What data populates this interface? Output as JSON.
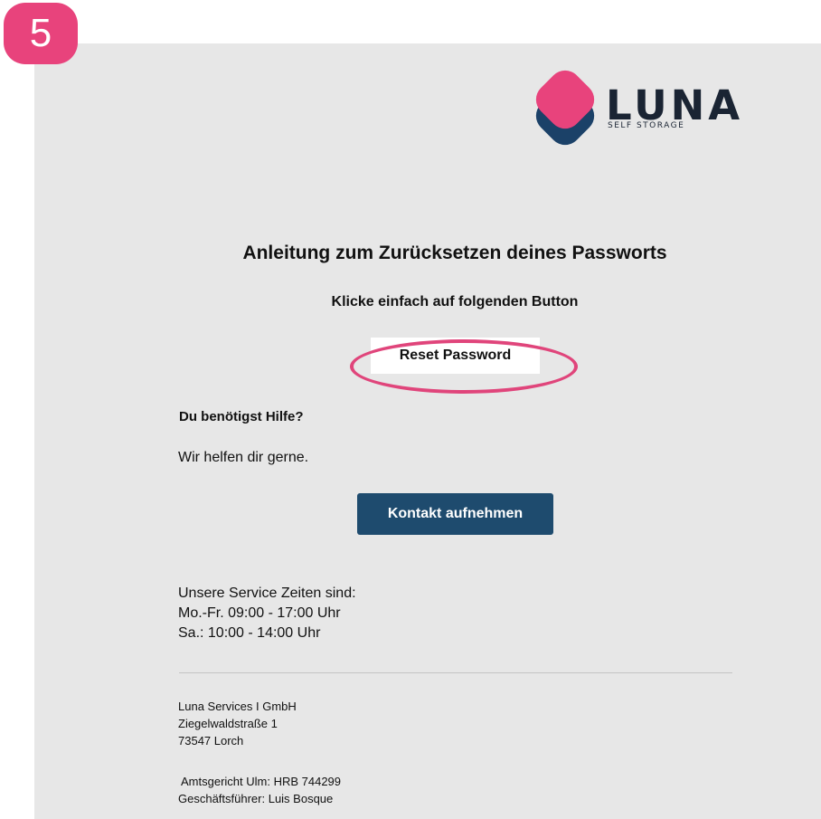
{
  "step_badge": "5",
  "logo": {
    "word": "LUNA",
    "sub": "SELF STORAGE",
    "pink": "#e8437c",
    "navy": "#1b4168"
  },
  "email": {
    "heading": "Anleitung zum Zurücksetzen deines Passworts",
    "subheading": "Klicke einfach auf folgenden Button",
    "reset_button": "Reset Password",
    "help_title": "Du benötigst Hilfe?",
    "help_text": "Wir helfen dir gerne.",
    "contact_button": "Kontakt aufnehmen",
    "hours": [
      "Unsere Service Zeiten sind:",
      "Mo.-Fr. 09:00 - 17:00 Uhr",
      "Sa.: 10:00 - 14:00 Uhr"
    ],
    "company": [
      "Luna Services I GmbH",
      "Ziegelwaldstraße 1",
      "73547 Lorch"
    ],
    "legal": [
      "Amtsgericht Ulm: HRB 744299",
      "Geschäftsführer: Luis Bosque"
    ]
  },
  "colors": {
    "highlight": "#e0457b",
    "contact_button_bg": "#1e4b6e",
    "panel_bg": "#e7e7e7"
  }
}
